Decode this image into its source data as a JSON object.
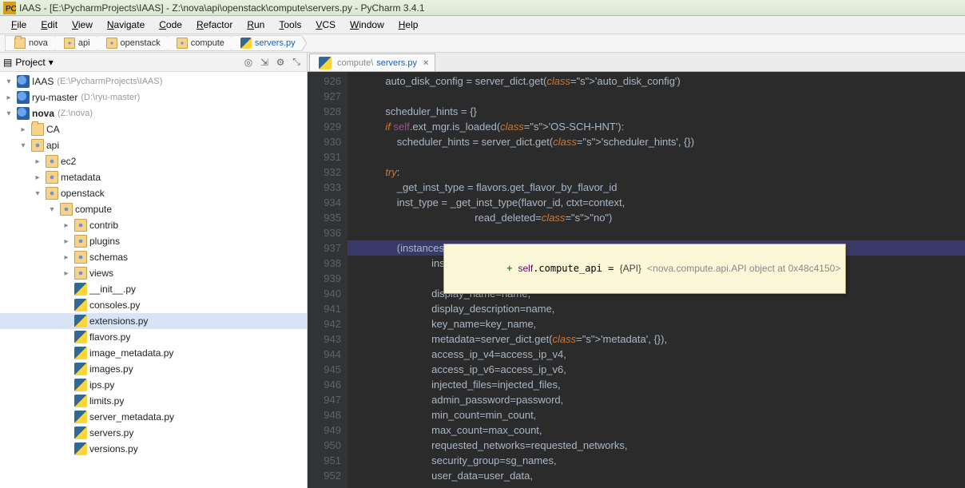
{
  "window_title": "IAAS - [E:\\PycharmProjects\\IAAS] - Z:\\nova\\api\\openstack\\compute\\servers.py - PyCharm 3.4.1",
  "menus": [
    "File",
    "Edit",
    "View",
    "Navigate",
    "Code",
    "Refactor",
    "Run",
    "Tools",
    "VCS",
    "Window",
    "Help"
  ],
  "breadcrumbs": [
    {
      "label": "nova",
      "icon": "folder"
    },
    {
      "label": "api",
      "icon": "pkg"
    },
    {
      "label": "openstack",
      "icon": "pkg"
    },
    {
      "label": "compute",
      "icon": "pkg"
    },
    {
      "label": "servers.py",
      "icon": "py",
      "file": true
    }
  ],
  "project_panel_title": "Project",
  "tree": [
    {
      "depth": 0,
      "expand": "▾",
      "icon": "proj",
      "label": "IAAS",
      "sub": "(E:\\PycharmProjects\\IAAS)"
    },
    {
      "depth": 0,
      "expand": "▸",
      "icon": "proj",
      "label": "ryu-master",
      "sub": "(D:\\ryu-master)"
    },
    {
      "depth": 0,
      "expand": "▾",
      "icon": "proj",
      "label": "nova",
      "sub": "(Z:\\nova)",
      "bold": true
    },
    {
      "depth": 1,
      "expand": "▸",
      "icon": "folder",
      "label": "CA"
    },
    {
      "depth": 1,
      "expand": "▾",
      "icon": "pkg",
      "label": "api"
    },
    {
      "depth": 2,
      "expand": "▸",
      "icon": "pkg",
      "label": "ec2"
    },
    {
      "depth": 2,
      "expand": "▸",
      "icon": "pkg",
      "label": "metadata"
    },
    {
      "depth": 2,
      "expand": "▾",
      "icon": "pkg",
      "label": "openstack"
    },
    {
      "depth": 3,
      "expand": "▾",
      "icon": "pkg",
      "label": "compute"
    },
    {
      "depth": 4,
      "expand": "▸",
      "icon": "pkg",
      "label": "contrib"
    },
    {
      "depth": 4,
      "expand": "▸",
      "icon": "pkg",
      "label": "plugins"
    },
    {
      "depth": 4,
      "expand": "▸",
      "icon": "pkg",
      "label": "schemas"
    },
    {
      "depth": 4,
      "expand": "▸",
      "icon": "pkg",
      "label": "views"
    },
    {
      "depth": 4,
      "expand": " ",
      "icon": "py",
      "label": "__init__.py"
    },
    {
      "depth": 4,
      "expand": " ",
      "icon": "py",
      "label": "consoles.py"
    },
    {
      "depth": 4,
      "expand": " ",
      "icon": "py",
      "label": "extensions.py",
      "selected": true
    },
    {
      "depth": 4,
      "expand": " ",
      "icon": "py",
      "label": "flavors.py"
    },
    {
      "depth": 4,
      "expand": " ",
      "icon": "py",
      "label": "image_metadata.py"
    },
    {
      "depth": 4,
      "expand": " ",
      "icon": "py",
      "label": "images.py"
    },
    {
      "depth": 4,
      "expand": " ",
      "icon": "py",
      "label": "ips.py"
    },
    {
      "depth": 4,
      "expand": " ",
      "icon": "py",
      "label": "limits.py"
    },
    {
      "depth": 4,
      "expand": " ",
      "icon": "py",
      "label": "server_metadata.py"
    },
    {
      "depth": 4,
      "expand": " ",
      "icon": "py",
      "label": "servers.py"
    },
    {
      "depth": 4,
      "expand": " ",
      "icon": "py",
      "label": "versions.py"
    }
  ],
  "editor_tab_path": "compute\\",
  "editor_tab_file": "servers.py",
  "chart_data": {
    "type": "code-listing",
    "first_line": 926,
    "highlighted_line": 937,
    "language": "python",
    "tooltip": {
      "symbol": "self.compute_api",
      "type": "{API}",
      "repr": "<nova.compute.api.API object at 0x48c4150>"
    },
    "lines": [
      {
        "n": 926,
        "t": "            auto_disk_config = server_dict.get('auto_disk_config')"
      },
      {
        "n": 927,
        "t": ""
      },
      {
        "n": 928,
        "t": "            scheduler_hints = {}"
      },
      {
        "n": 929,
        "t": "            if self.ext_mgr.is_loaded('OS-SCH-HNT'):"
      },
      {
        "n": 930,
        "t": "                scheduler_hints = server_dict.get('scheduler_hints', {})"
      },
      {
        "n": 931,
        "t": ""
      },
      {
        "n": 932,
        "t": "            try:"
      },
      {
        "n": 933,
        "t": "                _get_inst_type = flavors.get_flavor_by_flavor_id"
      },
      {
        "n": 934,
        "t": "                inst_type = _get_inst_type(flavor_id, ctxt=context,"
      },
      {
        "n": 935,
        "t": "                                           read_deleted=\"no\")"
      },
      {
        "n": 936,
        "t": ""
      },
      {
        "n": 937,
        "t": "                (instances, resv_id) = self.compute_api.create(context,"
      },
      {
        "n": 938,
        "t": "                            inst_type,"
      },
      {
        "n": 939,
        "t": ""
      },
      {
        "n": 940,
        "t": "                            display_name=name,"
      },
      {
        "n": 941,
        "t": "                            display_description=name,"
      },
      {
        "n": 942,
        "t": "                            key_name=key_name,"
      },
      {
        "n": 943,
        "t": "                            metadata=server_dict.get('metadata', {}),"
      },
      {
        "n": 944,
        "t": "                            access_ip_v4=access_ip_v4,"
      },
      {
        "n": 945,
        "t": "                            access_ip_v6=access_ip_v6,"
      },
      {
        "n": 946,
        "t": "                            injected_files=injected_files,"
      },
      {
        "n": 947,
        "t": "                            admin_password=password,"
      },
      {
        "n": 948,
        "t": "                            min_count=min_count,"
      },
      {
        "n": 949,
        "t": "                            max_count=max_count,"
      },
      {
        "n": 950,
        "t": "                            requested_networks=requested_networks,"
      },
      {
        "n": 951,
        "t": "                            security_group=sg_names,"
      },
      {
        "n": 952,
        "t": "                            user_data=user_data,"
      }
    ]
  },
  "tooltip_text": "+ self.compute_api = {API} <nova.compute.api.API object at 0x48c4150>"
}
